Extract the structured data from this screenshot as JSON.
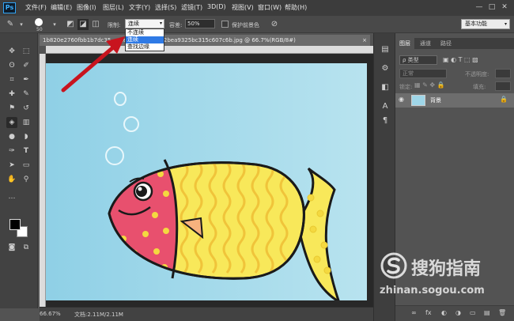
{
  "app": {
    "logo": "Ps"
  },
  "menu": [
    "文件(F)",
    "编辑(E)",
    "图像(I)",
    "图层(L)",
    "文字(Y)",
    "选择(S)",
    "滤镜(T)",
    "3D(D)",
    "视图(V)",
    "窗口(W)",
    "帮助(H)"
  ],
  "window_controls": {
    "minimize": "—",
    "restore": "□",
    "close": "✕"
  },
  "options": {
    "brush_size": "50",
    "mode_label": "限制:",
    "mode_value": "连续",
    "tolerance_label": "容差:",
    "tolerance_value": "50%",
    "protect_label": "保护前景色",
    "workspace": "基本功能"
  },
  "mode_dropdown": [
    {
      "label": "不连续",
      "selected": false
    },
    {
      "label": "连续",
      "selected": true
    },
    {
      "label": "查找边缘",
      "selected": false
    }
  ],
  "document": {
    "tab_title": "1b820e2760fbb1b7dc35…4eef01f3a29ec6f2bea9325bc315c607c6b.jpg @ 66.7%(RGB/8#)",
    "close": "×"
  },
  "status": {
    "zoom": "66.67%",
    "doc": "文档:2.11M/2.11M",
    "arrow": "›"
  },
  "layers_panel": {
    "tabs": [
      "图层",
      "通道",
      "路径"
    ],
    "kind_filter": "ρ 类型",
    "blend_mode": "正常",
    "opacity_label": "不透明度:",
    "lock_label": "锁定:",
    "fill_label": "填充:",
    "layer_name": "背景",
    "bottom_icons": [
      "∞",
      "fx",
      "◐",
      "◑",
      "▭",
      "▤",
      "🗑"
    ]
  },
  "watermark": {
    "brand": "搜狗指南",
    "url": "zhinan.sogou.com"
  },
  "colors": {
    "sky_left": "#8fd0e6",
    "sky_right": "#b8e3ef",
    "fish_head": "#e8506e",
    "fish_body": "#f8e85a",
    "fish_spot": "#f4d940",
    "arrow": "#c8141e"
  }
}
